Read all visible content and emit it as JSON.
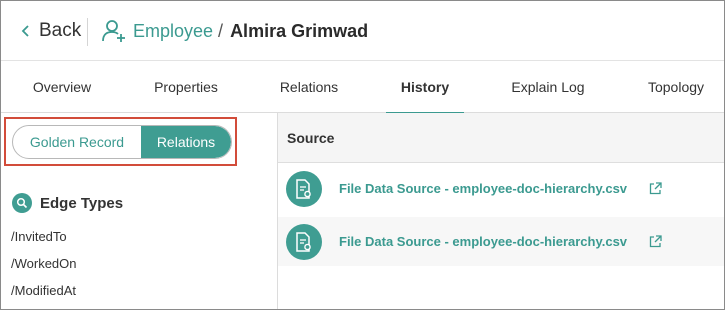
{
  "header": {
    "back_label": "Back",
    "entity_type": "Employee",
    "separator": "/",
    "entity_name": "Almira Grimwad"
  },
  "tabs": [
    {
      "label": "Overview",
      "active": false
    },
    {
      "label": "Properties",
      "active": false
    },
    {
      "label": "Relations",
      "active": false
    },
    {
      "label": "History",
      "active": true
    },
    {
      "label": "Explain Log",
      "active": false
    },
    {
      "label": "Topology",
      "active": false
    }
  ],
  "toggle": {
    "options": [
      "Golden Record",
      "Relations"
    ],
    "selected": "Relations"
  },
  "edge_types": {
    "title": "Edge Types",
    "items": [
      "/InvitedTo",
      "/WorkedOn",
      "/ModifiedAt"
    ]
  },
  "table": {
    "column_header": "Source",
    "rows": [
      {
        "label": "File Data Source - employee-doc-hierarchy.csv",
        "icon": "file-settings-icon"
      },
      {
        "label": "File Data Source - employee-doc-hierarchy.csv",
        "icon": "file-settings-icon"
      }
    ]
  },
  "colors": {
    "accent": "#3b9a90",
    "highlight_border": "#d24c3a"
  }
}
